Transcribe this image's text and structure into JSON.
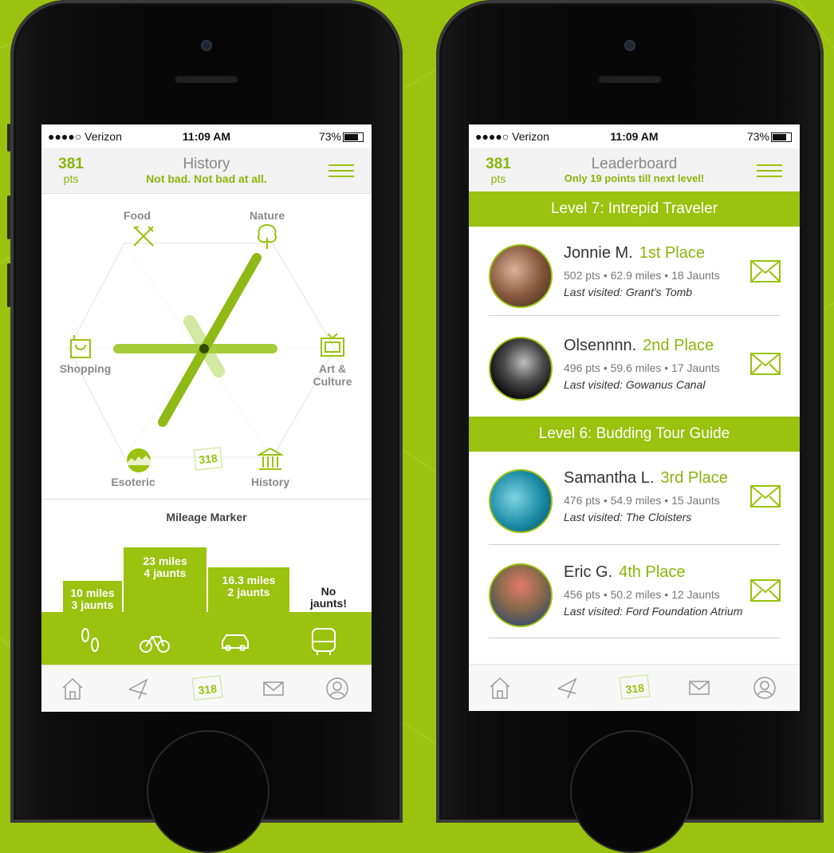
{
  "colors": {
    "accent": "#9ac20e",
    "accent_text": "#8cb40a",
    "background": "#9ac20e"
  },
  "status_bar": {
    "carrier": "●●●●○ Verizon",
    "time": "11:09 AM",
    "battery": "73%"
  },
  "history_screen": {
    "points": "381",
    "points_label": "pts",
    "title": "History",
    "subtitle": "Not bad. Not bad at all.",
    "categories": {
      "food": "Food",
      "nature": "Nature",
      "shopping": "Shopping",
      "art_culture_1": "Art &",
      "art_culture_2": "Culture",
      "esoteric": "Esoteric",
      "history": "History"
    },
    "center_badge": "318",
    "mileage_title": "Mileage Marker",
    "podium": [
      {
        "miles": "10 miles",
        "jaunts": "3 jaunts",
        "mode": "walk-icon"
      },
      {
        "miles": "23 miles",
        "jaunts": "4 jaunts",
        "mode": "bike-icon"
      },
      {
        "miles": "16.3 miles",
        "jaunts": "2 jaunts",
        "mode": "car-icon"
      },
      {
        "miles": "No",
        "jaunts": "jaunts!",
        "mode": "bus-icon"
      }
    ]
  },
  "leaderboard_screen": {
    "points": "381",
    "points_label": "pts",
    "title": "Leaderboard",
    "subtitle": "Only 19 points till next level!",
    "levels": [
      {
        "title": "Level 7: Intrepid Traveler"
      },
      {
        "title": "Level 6: Budding Tour Guide"
      }
    ],
    "entries": [
      {
        "name": "Jonnie M.",
        "place": "1st Place",
        "stats": "502 pts • 62.9 miles • 18 Jaunts",
        "last": "Last visited: Grant’s Tomb"
      },
      {
        "name": "Olsennnn.",
        "place": "2nd Place",
        "stats": "496 pts • 59.6 miles • 17 Jaunts",
        "last": "Last visited: Gowanus Canal"
      },
      {
        "name": "Samantha L.",
        "place": "3rd Place",
        "stats": "476 pts • 54.9 miles • 15 Jaunts",
        "last": "Last visited: The Cloisters"
      },
      {
        "name": "Eric G.",
        "place": "4th Place",
        "stats": "456 pts • 50.2 miles • 12 Jaunts",
        "last": "Last visited: Ford Foundation Atrium"
      }
    ]
  },
  "tabbar": {
    "badge": "318",
    "items": [
      "home-icon",
      "map-pin-icon",
      "badge-318-icon",
      "mail-icon",
      "profile-icon"
    ]
  }
}
